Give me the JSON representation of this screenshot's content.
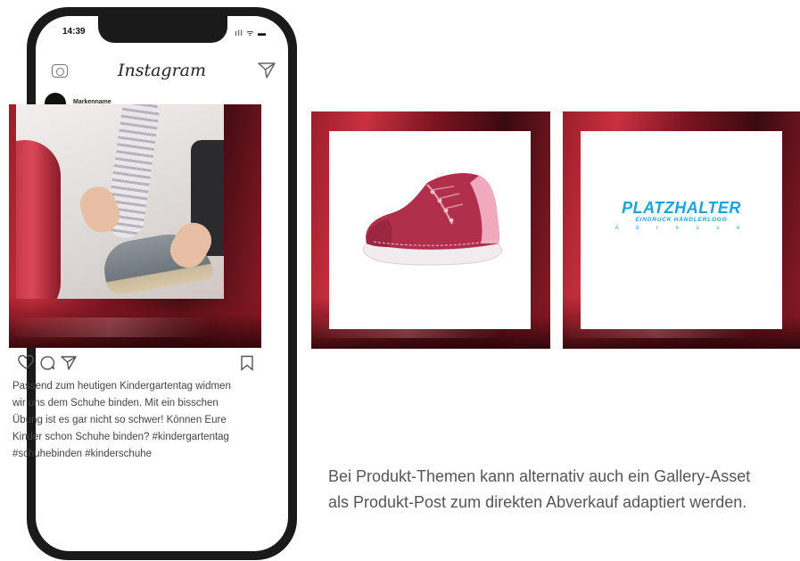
{
  "status_bar": {
    "time": "14:39",
    "indicators": "ıll ᯤ ▬"
  },
  "instagram": {
    "logo": "Instagram",
    "icons": {
      "camera": "camera-icon",
      "direct": "direct-message-icon"
    },
    "post": {
      "username": "Markenname",
      "caption": "Passend zum heutigen Kindergartentag widmen wir uns dem Schuhe binden. Mit ein bisschen Übung ist es gar nicht so schwer! Können Eure Kinder schon Schuhe binden? #kindergartentag #schuhebinden #kinderschuhe",
      "actions": [
        "heart-icon",
        "comment-icon",
        "share-icon",
        "bookmark-icon"
      ]
    }
  },
  "gallery": {
    "placeholder": {
      "title": "PLATZHALTER",
      "subtitle": "EINDRUCK HÄNDLERLOGO",
      "line": "A d r e s s e"
    }
  },
  "description": "Bei Produkt-Themen kann alternativ auch ein Gallery-Asset als Produkt-Post zum direkten Abverkauf adaptiert werden.",
  "colors": {
    "brand_red": "#9c1d2b",
    "placeholder_blue": "#1fa3d6",
    "phone_frame": "#1a1a1a"
  }
}
